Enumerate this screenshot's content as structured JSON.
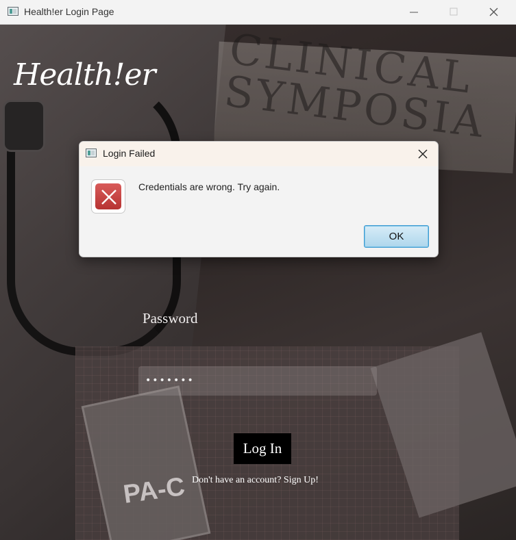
{
  "window": {
    "title": "Health!er Login Page",
    "controls": [
      "minimize-icon",
      "maximize-icon",
      "close-icon"
    ]
  },
  "app": {
    "logo": "Health!er"
  },
  "background": {
    "poster_text": "CLINICAL SYMPOSIA",
    "badge_text": "PA-C"
  },
  "form": {
    "password_label": "Password",
    "password_value": "•••••••",
    "login_button": "Log In",
    "signup_text": "Don't have an account? Sign Up!"
  },
  "dialog": {
    "title": "Login Failed",
    "message": "Credentials are wrong. Try again.",
    "ok_button": "OK",
    "icon": "error-icon"
  },
  "colors": {
    "dialog_ok_border": "#3e9bd1",
    "error_red": "#c94645",
    "login_button_bg": "#000000"
  }
}
